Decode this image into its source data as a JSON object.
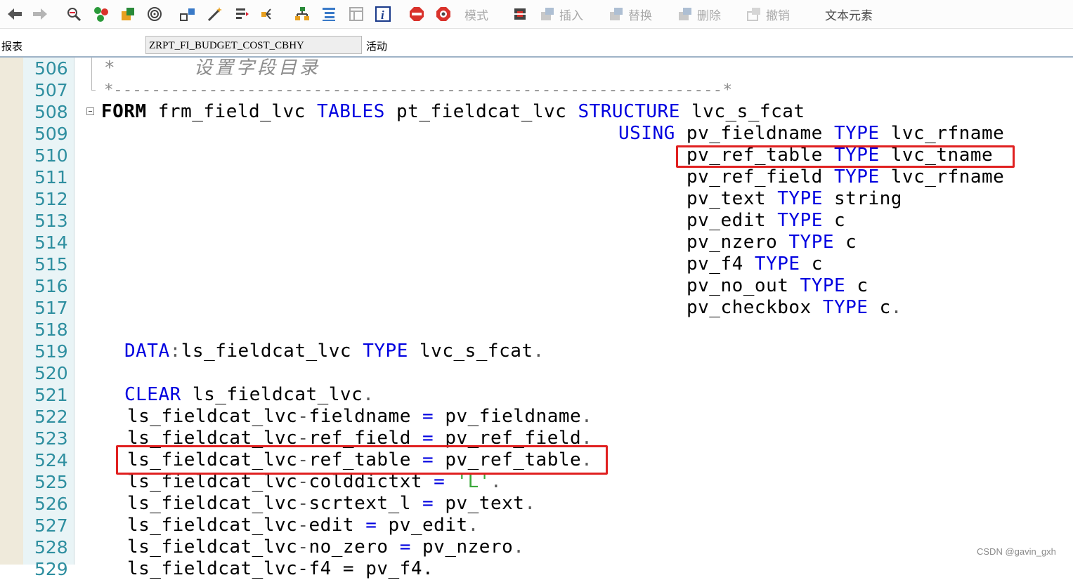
{
  "toolbar": {
    "mode_label": "模式",
    "insert_label": "插入",
    "replace_label": "替换",
    "delete_label": "删除",
    "undo_label": "撤销",
    "text_element_label": "文本元素"
  },
  "infobar": {
    "report_label": "报表",
    "program_name": "ZRPT_FI_BUDGET_COST_CBHY",
    "status": "活动"
  },
  "line_numbers": [
    "506",
    "507",
    "508",
    "509",
    "510",
    "511",
    "512",
    "513",
    "514",
    "515",
    "516",
    "517",
    "518",
    "519",
    "520",
    "521",
    "522",
    "523",
    "524",
    "525",
    "526",
    "527",
    "528",
    "529"
  ],
  "code": {
    "l506_star": "*",
    "l506_comment": "设置字段目录",
    "l507": "*----------------------------------------------------------------*",
    "l508_kw1": "FORM",
    "l508_t1": " frm_field_lvc ",
    "l508_kw2": "TABLES",
    "l508_t2": " pt_fieldcat_lvc ",
    "l508_kw3": "STRUCTURE",
    "l508_t3": " lvc_s_fcat",
    "l509_kw": "USING",
    "l509_t1": " pv_fieldname ",
    "l509_kw2": "TYPE",
    "l509_t2": " lvc_rfname",
    "l510_t1": "pv_ref_table ",
    "l510_kw": "TYPE",
    "l510_t2": " lvc_tname",
    "l511_t1": "pv_ref_field ",
    "l511_kw": "TYPE",
    "l511_t2": " lvc_rfname",
    "l512_t1": "pv_text ",
    "l512_kw": "TYPE",
    "l512_t2": " string",
    "l513_t1": "pv_edit ",
    "l513_kw": "TYPE",
    "l513_t2": " c",
    "l514_t1": "pv_nzero ",
    "l514_kw": "TYPE",
    "l514_t2": " c",
    "l515_t1": "pv_f4 ",
    "l515_kw": "TYPE",
    "l515_t2": " c",
    "l516_t1": "pv_no_out ",
    "l516_kw": "TYPE",
    "l516_t2": " c",
    "l517_t1": "pv_checkbox ",
    "l517_kw": "TYPE",
    "l517_t2": " c",
    "l517_p": ".",
    "l519_kw": "DATA",
    "l519_p": ":",
    "l519_t1": "ls_fieldcat_lvc ",
    "l519_kw2": "TYPE",
    "l519_t2": " lvc_s_fcat",
    "l519_p2": ".",
    "l521_kw": "CLEAR",
    "l521_t1": " ls_fieldcat_lvc",
    "l521_p": ".",
    "l522_a": "ls_fieldcat_lvc",
    "l522_d": "-",
    "l522_b": "fieldname ",
    "l522_eq": "=",
    "l522_c": " pv_fieldname",
    "l522_p": ".",
    "l523_a": "ls_fieldcat_lvc",
    "l523_d": "-",
    "l523_b": "ref_field ",
    "l523_eq": "=",
    "l523_c": " pv_ref_field",
    "l523_p": ".",
    "l524_a": "ls_fieldcat_lvc",
    "l524_d": "-",
    "l524_b": "ref_table ",
    "l524_eq": "=",
    "l524_c": " pv_ref_table",
    "l524_p": ".",
    "l525_a": "ls_fieldcat_lvc",
    "l525_d": "-",
    "l525_b": "colddictxt ",
    "l525_eq": "=",
    "l525_c": " 'L'",
    "l525_p": ".",
    "l526_a": "ls_fieldcat_lvc",
    "l526_d": "-",
    "l526_b": "scrtext_l ",
    "l526_eq": "=",
    "l526_c": " pv_text",
    "l526_p": ".",
    "l527_a": "ls_fieldcat_lvc",
    "l527_d": "-",
    "l527_b": "edit ",
    "l527_eq": "=",
    "l527_c": " pv_edit",
    "l527_p": ".",
    "l528_a": "ls_fieldcat_lvc",
    "l528_d": "-",
    "l528_b": "no_zero ",
    "l528_eq": "=",
    "l528_c": " pv_nzero",
    "l528_p": ".",
    "l529": "ls_fieldcat_lvc-f4 = pv_f4."
  },
  "watermark": "CSDN @gavin_gxh",
  "colors": {
    "keyword": "#0000e0",
    "line_number": "#2f8fa0",
    "comment": "#8c8c8c",
    "string": "#3aa83a",
    "highlight_box": "#e02020",
    "gutter_bg": "#e9f4f6"
  }
}
